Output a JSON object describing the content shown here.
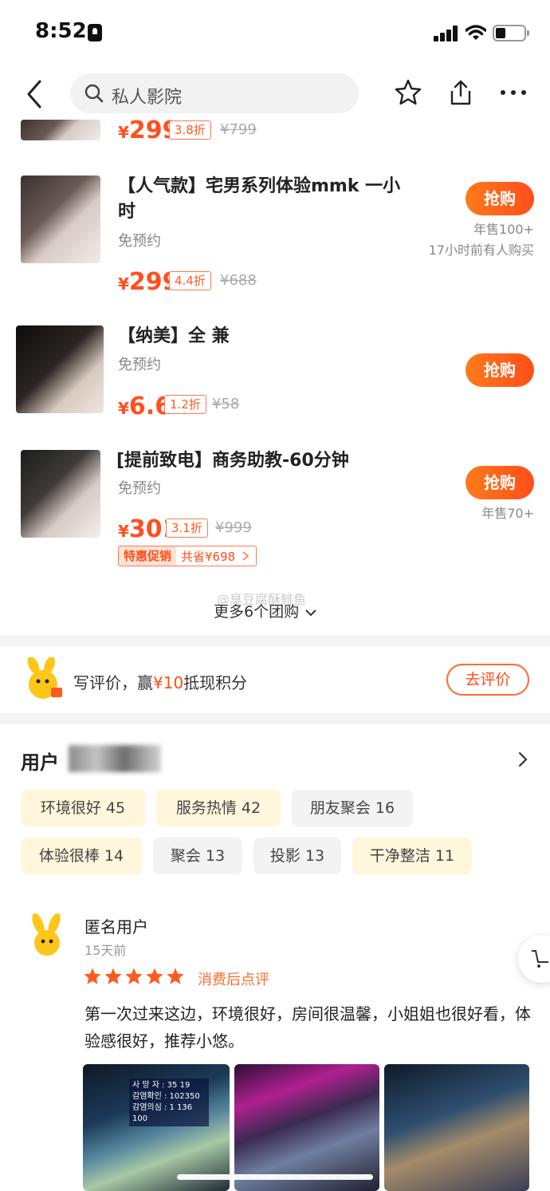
{
  "status_bar": {
    "time": "8:52"
  },
  "search": {
    "placeholder": "私人影院"
  },
  "items": [
    {
      "price_yen": "¥",
      "price": "299",
      "discount": "3.8折",
      "original": "¥799"
    },
    {
      "title_line1": "【人气款】宅男系列体验mmk 一小",
      "title_line2": "时",
      "subtitle": "免预约",
      "price_yen": "¥",
      "price": "299",
      "discount": "4.4折",
      "original": "¥688",
      "buy": "抢购",
      "sales": "年售100+",
      "recent": "17小时前有人购买"
    },
    {
      "title_line1": "【纳美】全  兼",
      "subtitle": "免预约",
      "price_yen": "¥",
      "price": "6.6",
      "discount": "1.2折",
      "original": "¥58",
      "buy": "抢购"
    },
    {
      "title_line1": "[提前致电】商务助教-60分钟",
      "subtitle": "免预约",
      "price_yen": "¥",
      "price": "301",
      "discount": "3.1折",
      "original": "¥999",
      "buy": "抢购",
      "sales": "年售70+",
      "promo_label": "特惠促销",
      "promo_saving": "共省¥698"
    }
  ],
  "watermark": "@臭豆腐酥鲱鱼",
  "more_groups": "更多6个团购",
  "review_prompt": {
    "text_before": "写评价，赢",
    "accent": "¥10",
    "text_after": "抵现积分",
    "button": "去评价"
  },
  "reviews": {
    "title_prefix": "用户",
    "tags": [
      "环境很好 45",
      "服务热情 42",
      "朋友聚会 16",
      "体验很棒 14",
      "聚会 13",
      "投影 13",
      "干净整洁 11"
    ],
    "first": {
      "name": "匿名用户",
      "time": "15天前",
      "rating": 5,
      "label": "消费后点评",
      "text": "第一次过来这边，环境很好，房间很温馨，小姐姐也很好看，体验感很好，推荐小悠。",
      "photo1_screen": [
        "사 망 자 : 35 19",
        "감염확인 : 102350",
        "감염의심 : 1 136 100"
      ]
    }
  },
  "colors": {
    "accent": "#ff4e1a",
    "tag_warm": "#fff6dc",
    "tag_grey": "#f3f3f3"
  }
}
